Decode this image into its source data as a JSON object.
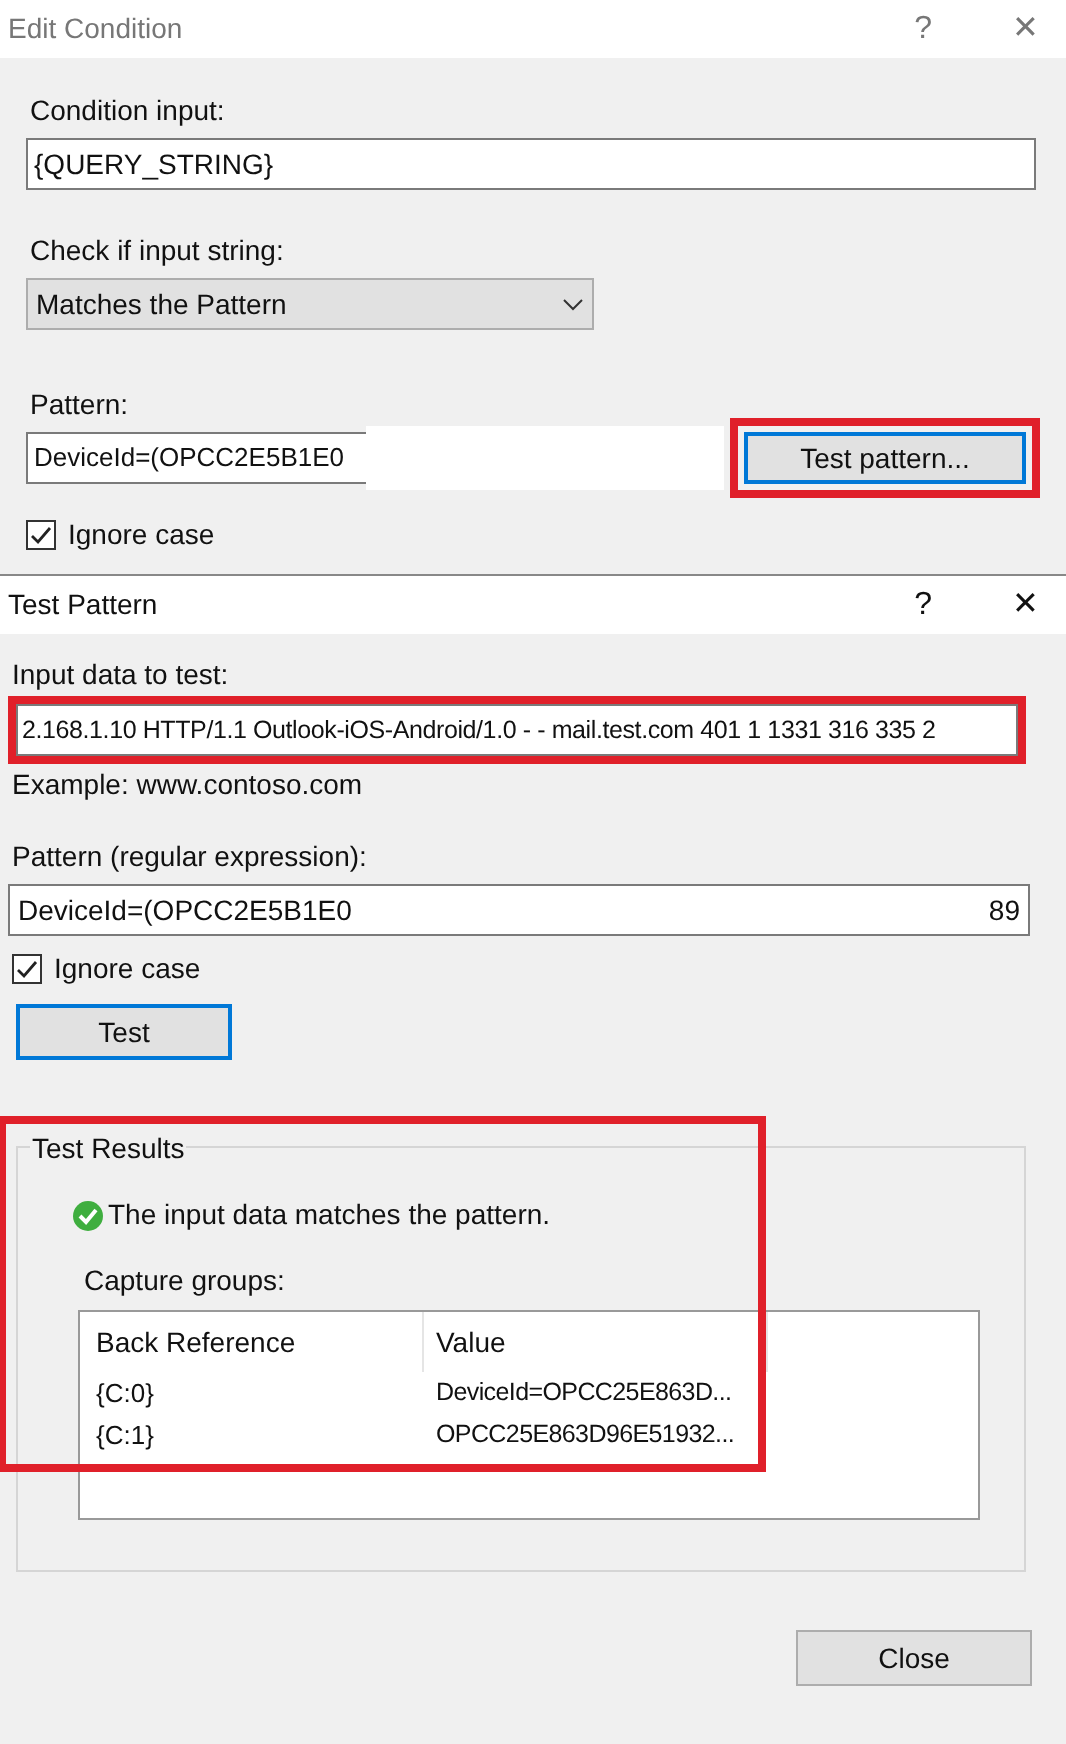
{
  "edit_dialog": {
    "title": "Edit Condition",
    "help": "?",
    "close": "✕",
    "condition_label": "Condition input:",
    "condition_value": "{QUERY_STRING}",
    "check_label": "Check if input string:",
    "check_value": "Matches the Pattern",
    "pattern_label": "Pattern:",
    "pattern_value": "DeviceId=(OPCC2E5B1E0",
    "test_button": "Test pattern...",
    "ignore_case": {
      "label": "Ignore case",
      "checked": true
    }
  },
  "test_dialog": {
    "title": "Test Pattern",
    "help": "?",
    "close": "✕",
    "input_label": "Input data to test:",
    "input_value": "2.168.1.10 HTTP/1.1 Outlook-iOS-Android/1.0 - - mail.test.com 401 1 1331 316 335 2",
    "example": "Example: www.contoso.com",
    "pattern_label": "Pattern (regular expression):",
    "pattern_value": "DeviceId=(OPCC2E5B1E0",
    "pattern_value_end": "89",
    "ignore_case": {
      "label": "Ignore case",
      "checked": true
    },
    "test_button": "Test",
    "results": {
      "title": "Test Results",
      "message": "The input data matches the pattern.",
      "groups_label": "Capture groups:",
      "columns": [
        "Back Reference",
        "Value"
      ],
      "rows": [
        [
          "{C:0}",
          "DeviceId=OPCC25E863D..."
        ],
        [
          "{C:1}",
          "OPCC25E863D96E51932..."
        ]
      ]
    },
    "close_button": "Close"
  }
}
